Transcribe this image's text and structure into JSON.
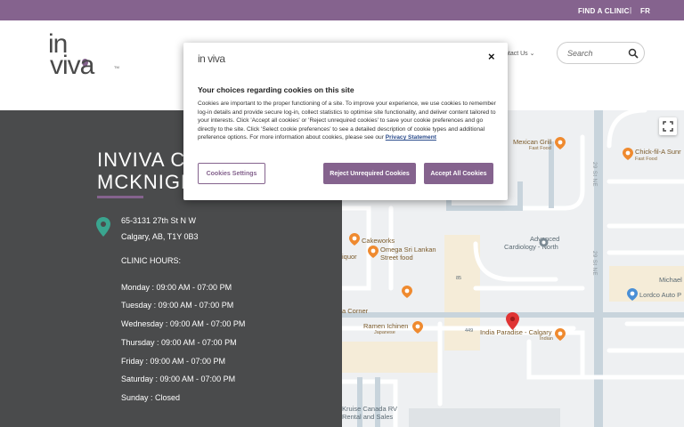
{
  "topbar": {
    "find_clinic": "FIND A CLINIC",
    "separator": "|",
    "lang": "FR"
  },
  "header": {
    "logo_line1": "in",
    "logo_line2": "viva",
    "logo_tm": "TM",
    "nav_contact": "ntact Us",
    "search_placeholder": "Search"
  },
  "clinic": {
    "title_line1": "INVIVA C",
    "title_line2": "MCKNIGH",
    "address_line1": "65-3131 27th St N W",
    "address_line2": "Calgary, AB, T1Y 0B3",
    "hours_label": "CLINIC HOURS:",
    "hours": [
      "Monday : 09:00 AM - 07:00 PM",
      "Tuesday : 09:00 AM - 07:00 PM",
      "Wednesday : 09:00 AM - 07:00 PM",
      "Thursday : 09:00 AM - 07:00 PM",
      "Friday : 09:00 AM - 07:00 PM",
      "Saturday : 09:00 AM - 07:00 PM",
      "Sunday : Closed"
    ]
  },
  "map": {
    "places": {
      "mexican": "Mexican Grill",
      "mexican_sub": "Fast Food",
      "chickfila": "Chick-fil-A Sunr",
      "chickfila_sub": "Fast Food",
      "cakeworks": "Cakeworks",
      "omega1": "Omega Sri Lankan",
      "omega2": "Street food",
      "advanced1": "Advanced",
      "advanced2": "Cardiology - North",
      "iquor": "iquor",
      "michael": "Michael",
      "lordco": "Lordco Auto P",
      "corner": "a Corner",
      "ramen": "Ramen Ichinen",
      "ramen_sub": "Japanese",
      "india": "India Paradise - Calgary",
      "india_sub": "Indian",
      "kruise1": "Kruise Canada RV",
      "kruise2": "Rental and Sales",
      "num85": "85",
      "num449": "449"
    },
    "roads": [
      "29 St NE",
      "29 St NE"
    ]
  },
  "cookie_modal": {
    "logo": "in viva",
    "close": "×",
    "heading": "Your choices regarding cookies on this site",
    "body": "Cookies are important to the proper functioning of a site. To improve your experience, we use cookies to remember log-in details and provide secure log-in, collect statistics to optimise site functionality, and deliver content tailored to your interests. Click 'Accept all cookies' or 'Reject unrequired cookies' to save your cookie preferences and go directly to the site. Click 'Select cookie preferences' to see a detailed description of cookie types and additional preference options. For more information about cookies, please see our",
    "privacy_link": "Privacy Statement",
    "settings_btn": "Cookies Settings",
    "reject_btn": "Reject Unrequired Cookies",
    "accept_btn": "Accept All Cookies"
  },
  "colors": {
    "brand": "#85638e",
    "panel": "#4a4b4c",
    "pin_teal": "#3aa58f",
    "map_pin": "#e03434"
  }
}
